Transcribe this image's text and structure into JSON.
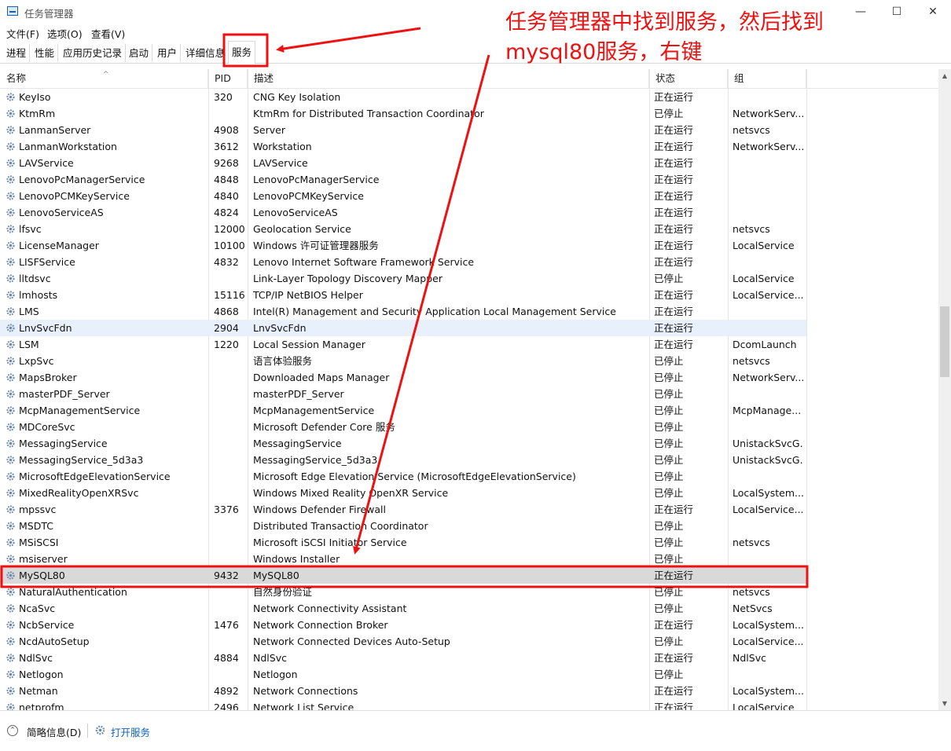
{
  "window": {
    "title": "任务管理器",
    "controls": [
      "—",
      "☐",
      "✕"
    ]
  },
  "menu": [
    "文件(F)",
    "选项(O)",
    "查看(V)"
  ],
  "tabs": [
    "进程",
    "性能",
    "应用历史记录",
    "启动",
    "用户",
    "详细信息",
    "服务"
  ],
  "active_tab": "服务",
  "columns": {
    "name": "名称",
    "pid": "PID",
    "desc": "描述",
    "status": "状态",
    "group": "组"
  },
  "rows": [
    {
      "name": "KeyIso",
      "pid": "320",
      "desc": "CNG Key Isolation",
      "status": "正在运行",
      "group": ""
    },
    {
      "name": "KtmRm",
      "pid": "",
      "desc": "KtmRm for Distributed Transaction Coordinator",
      "status": "已停止",
      "group": "NetworkServ..."
    },
    {
      "name": "LanmanServer",
      "pid": "4908",
      "desc": "Server",
      "status": "正在运行",
      "group": "netsvcs"
    },
    {
      "name": "LanmanWorkstation",
      "pid": "3612",
      "desc": "Workstation",
      "status": "正在运行",
      "group": "NetworkServ..."
    },
    {
      "name": "LAVService",
      "pid": "9268",
      "desc": "LAVService",
      "status": "正在运行",
      "group": ""
    },
    {
      "name": "LenovoPcManagerService",
      "pid": "4848",
      "desc": "LenovoPcManagerService",
      "status": "正在运行",
      "group": ""
    },
    {
      "name": "LenovoPCMKeyService",
      "pid": "4840",
      "desc": "LenovoPCMKeyService",
      "status": "正在运行",
      "group": ""
    },
    {
      "name": "LenovoServiceAS",
      "pid": "4824",
      "desc": "LenovoServiceAS",
      "status": "正在运行",
      "group": ""
    },
    {
      "name": "lfsvc",
      "pid": "12000",
      "desc": "Geolocation Service",
      "status": "正在运行",
      "group": "netsvcs"
    },
    {
      "name": "LicenseManager",
      "pid": "10100",
      "desc": "Windows 许可证管理器服务",
      "status": "正在运行",
      "group": "LocalService"
    },
    {
      "name": "LISFService",
      "pid": "4832",
      "desc": "Lenovo Internet Software Framework Service",
      "status": "正在运行",
      "group": ""
    },
    {
      "name": "lltdsvc",
      "pid": "",
      "desc": "Link-Layer Topology Discovery Mapper",
      "status": "已停止",
      "group": "LocalService"
    },
    {
      "name": "lmhosts",
      "pid": "15116",
      "desc": "TCP/IP NetBIOS Helper",
      "status": "正在运行",
      "group": "LocalService..."
    },
    {
      "name": "LMS",
      "pid": "4868",
      "desc": "Intel(R) Management and Security Application Local Management Service",
      "status": "正在运行",
      "group": ""
    },
    {
      "name": "LnvSvcFdn",
      "pid": "2904",
      "desc": "LnvSvcFdn",
      "status": "正在运行",
      "group": ""
    },
    {
      "name": "LSM",
      "pid": "1220",
      "desc": "Local Session Manager",
      "status": "正在运行",
      "group": "DcomLaunch"
    },
    {
      "name": "LxpSvc",
      "pid": "",
      "desc": "语言体验服务",
      "status": "已停止",
      "group": "netsvcs"
    },
    {
      "name": "MapsBroker",
      "pid": "",
      "desc": "Downloaded Maps Manager",
      "status": "已停止",
      "group": "NetworkServ..."
    },
    {
      "name": "masterPDF_Server",
      "pid": "",
      "desc": "masterPDF_Server",
      "status": "已停止",
      "group": ""
    },
    {
      "name": "McpManagementService",
      "pid": "",
      "desc": "McpManagementService",
      "status": "已停止",
      "group": "McpManage..."
    },
    {
      "name": "MDCoreSvc",
      "pid": "",
      "desc": "Microsoft Defender Core 服务",
      "status": "已停止",
      "group": ""
    },
    {
      "name": "MessagingService",
      "pid": "",
      "desc": "MessagingService",
      "status": "已停止",
      "group": "UnistackSvcG..."
    },
    {
      "name": "MessagingService_5d3a3",
      "pid": "",
      "desc": "MessagingService_5d3a3",
      "status": "已停止",
      "group": "UnistackSvcG..."
    },
    {
      "name": "MicrosoftEdgeElevationService",
      "pid": "",
      "desc": "Microsoft Edge Elevation Service (MicrosoftEdgeElevationService)",
      "status": "已停止",
      "group": ""
    },
    {
      "name": "MixedRealityOpenXRSvc",
      "pid": "",
      "desc": "Windows Mixed Reality OpenXR Service",
      "status": "已停止",
      "group": "LocalSystem..."
    },
    {
      "name": "mpssvc",
      "pid": "3376",
      "desc": "Windows Defender Firewall",
      "status": "正在运行",
      "group": "LocalService..."
    },
    {
      "name": "MSDTC",
      "pid": "",
      "desc": "Distributed Transaction Coordinator",
      "status": "已停止",
      "group": ""
    },
    {
      "name": "MSiSCSI",
      "pid": "",
      "desc": "Microsoft iSCSI Initiator Service",
      "status": "已停止",
      "group": "netsvcs"
    },
    {
      "name": "msiserver",
      "pid": "",
      "desc": "Windows Installer",
      "status": "已停止",
      "group": ""
    },
    {
      "name": "MySQL80",
      "pid": "9432",
      "desc": "MySQL80",
      "status": "正在运行",
      "group": ""
    },
    {
      "name": "NaturalAuthentication",
      "pid": "",
      "desc": "自然身份验证",
      "status": "已停止",
      "group": "netsvcs"
    },
    {
      "name": "NcaSvc",
      "pid": "",
      "desc": "Network Connectivity Assistant",
      "status": "已停止",
      "group": "NetSvcs"
    },
    {
      "name": "NcbService",
      "pid": "1476",
      "desc": "Network Connection Broker",
      "status": "正在运行",
      "group": "LocalSystem..."
    },
    {
      "name": "NcdAutoSetup",
      "pid": "",
      "desc": "Network Connected Devices Auto-Setup",
      "status": "已停止",
      "group": "LocalService..."
    },
    {
      "name": "NdlSvc",
      "pid": "4884",
      "desc": "NdlSvc",
      "status": "正在运行",
      "group": "NdlSvc"
    },
    {
      "name": "Netlogon",
      "pid": "",
      "desc": "Netlogon",
      "status": "已停止",
      "group": ""
    },
    {
      "name": "Netman",
      "pid": "4892",
      "desc": "Network Connections",
      "status": "正在运行",
      "group": "LocalSystem..."
    },
    {
      "name": "netprofm",
      "pid": "2496",
      "desc": "Network List Service",
      "status": "正在运行",
      "group": "LocalService"
    }
  ],
  "selected_row": "MySQL80",
  "hover_row": "LnvSvcFdn",
  "footer": {
    "fewer_details": "简略信息(D)",
    "open_services": "打开服务"
  },
  "annotation": {
    "text": "任务管理器中找到服务，然后找到\nmysql80服务，右键",
    "color": "#ee1111"
  }
}
